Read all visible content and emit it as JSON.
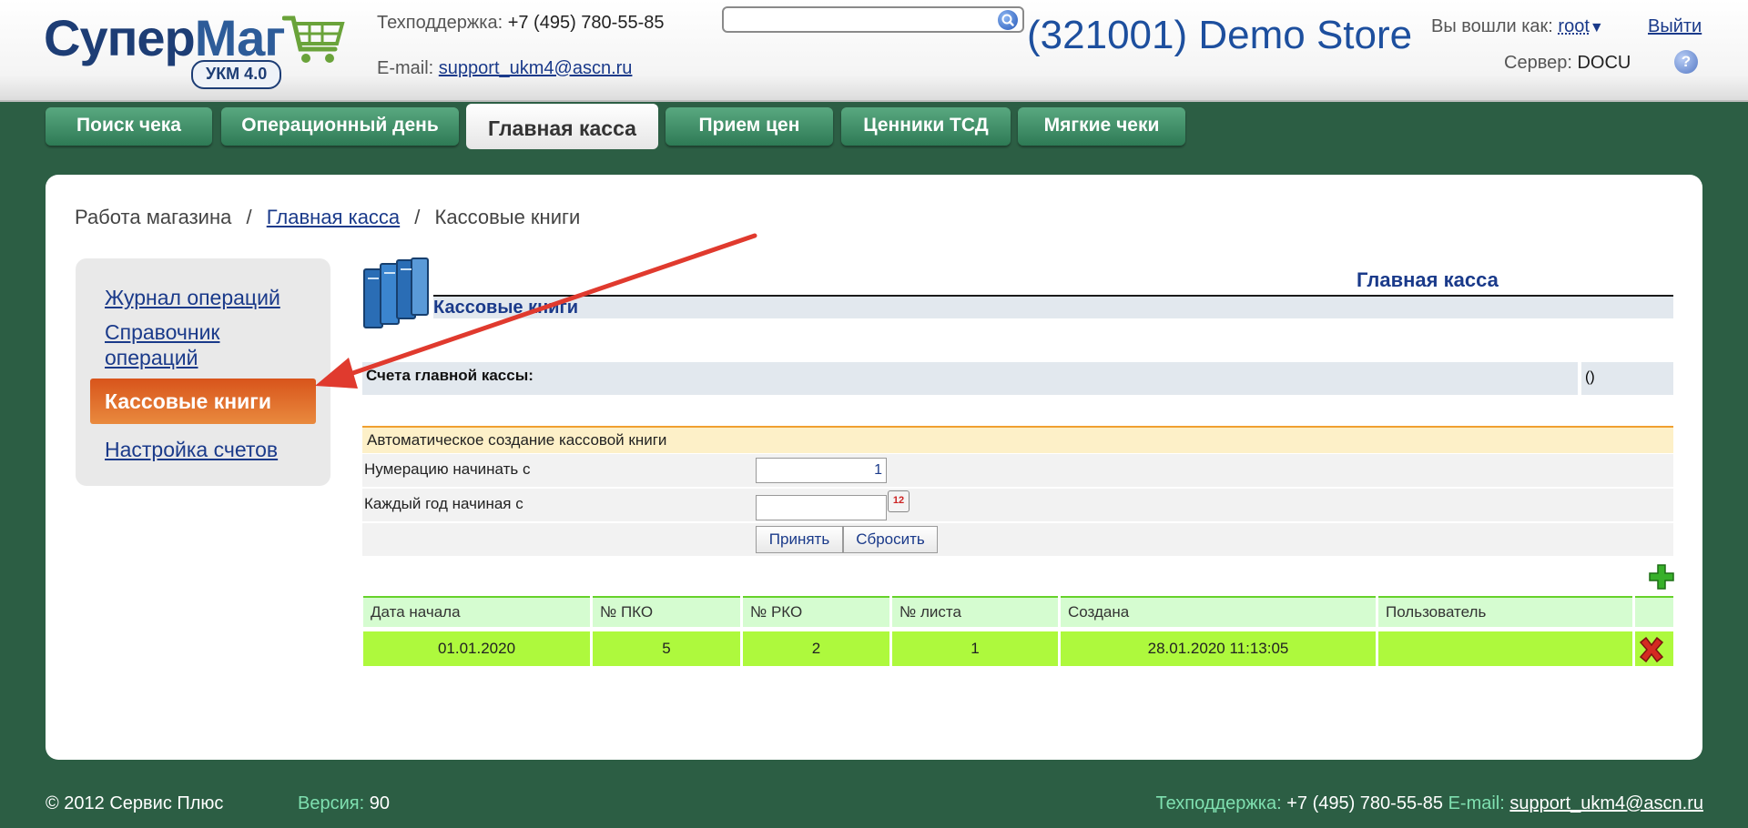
{
  "header": {
    "logo": {
      "brand_part1": "Супер",
      "brand_part2": "Маг",
      "badge": "УКМ 4.0"
    },
    "support_label": "Техподдержка:",
    "support_phone": "+7 (495) 780-55-85",
    "email_label": "E-mail:",
    "email": "support_ukm4@ascn.ru",
    "search_value": "",
    "store_title": "(321001) Demo Store",
    "logged_in_label": "Вы вошли как:",
    "user": "root",
    "user_caret": "▼",
    "logout": "Выйти",
    "server_label": "Сервер:",
    "server_value": "DOCU",
    "help_icon": "?"
  },
  "tabs": [
    {
      "label": "Поиск чека",
      "active": false
    },
    {
      "label": "Операционный день",
      "active": false
    },
    {
      "label": "Главная касса",
      "active": true
    },
    {
      "label": "Прием цен",
      "active": false
    },
    {
      "label": "Ценники ТСД",
      "active": false
    },
    {
      "label": "Мягкие чеки",
      "active": false
    }
  ],
  "breadcrumb": {
    "root": "Работа магазина",
    "sep": "/",
    "parent": "Главная касса",
    "current": "Кассовые книги"
  },
  "sidebar": {
    "items": [
      {
        "label": "Журнал операций"
      },
      {
        "label": "Справочник операций"
      },
      {
        "label": "Кассовые книги",
        "active": true
      },
      {
        "label": "Настройка счетов"
      }
    ]
  },
  "main": {
    "section_title": "Главная касса",
    "sub_title": "Кассовые книги",
    "icon": "books-icon",
    "accounts_label": "Счета главной кассы:",
    "accounts_value": "()",
    "auto_create_title": "Автоматическое создание кассовой книги",
    "form": {
      "numbering_label": "Нумерацию начинать с",
      "numbering_value": "1",
      "year_label": "Каждый год начиная с",
      "year_value": "",
      "calendar_icon": "12",
      "accept_button": "Принять",
      "reset_button": "Сбросить"
    },
    "table": {
      "columns": [
        "Дата начала",
        "№ ПКО",
        "№ РКО",
        "№ листа",
        "Создана",
        "Пользователь"
      ],
      "rows": [
        {
          "start_date": "01.01.2020",
          "pko": "5",
          "rko": "2",
          "sheet": "1",
          "created": "28.01.2020 11:13:05",
          "user": ""
        }
      ]
    }
  },
  "footer": {
    "copyright": "© 2012 Сервис Плюс",
    "version_label": "Версия:",
    "version": "90",
    "support_label": "Техподдержка:",
    "support_phone": "+7 (495) 780-55-85",
    "email_label": "E-mail:",
    "email": "support_ukm4@ascn.ru"
  },
  "colors": {
    "background": "#2c5e44",
    "tab": "#3e8d66",
    "active_sidebar": "#e0682a",
    "table_header": "#d5fcd0",
    "table_row": "#aef93d",
    "annotation_arrow": "#e03a2e"
  }
}
